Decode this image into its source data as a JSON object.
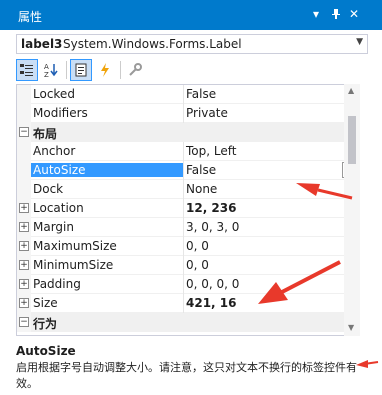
{
  "window": {
    "title": "属性",
    "pin_glyph": "▾",
    "autohide_glyph": "ᛘ",
    "close_glyph": "✕"
  },
  "object_selector": {
    "name": "label3",
    "type": "System.Windows.Forms.Label"
  },
  "toolbar": {
    "buttons": [
      {
        "icon": "categorized-icon"
      },
      {
        "icon": "alphabetical-icon"
      },
      {
        "icon": "properties-icon"
      },
      {
        "icon": "events-icon"
      },
      {
        "icon": "property-pages-icon"
      }
    ]
  },
  "grid": {
    "rows": [
      {
        "kind": "prop",
        "name": "Locked",
        "value": "False",
        "expandable": false,
        "bold": false
      },
      {
        "kind": "prop",
        "name": "Modifiers",
        "value": "Private",
        "expandable": false,
        "bold": false
      },
      {
        "kind": "category",
        "name": "布局",
        "glyph": "⊟"
      },
      {
        "kind": "prop",
        "name": "Anchor",
        "value": "Top, Left",
        "expandable": false,
        "bold": false
      },
      {
        "kind": "prop",
        "name": "AutoSize",
        "value": "False",
        "expandable": false,
        "bold": false,
        "selected": true
      },
      {
        "kind": "prop",
        "name": "Dock",
        "value": "None",
        "expandable": false,
        "bold": false
      },
      {
        "kind": "prop",
        "name": "Location",
        "value": "12, 236",
        "expandable": true,
        "bold": true
      },
      {
        "kind": "prop",
        "name": "Margin",
        "value": "3, 0, 3, 0",
        "expandable": true,
        "bold": false
      },
      {
        "kind": "prop",
        "name": "MaximumSize",
        "value": "0, 0",
        "expandable": true,
        "bold": false
      },
      {
        "kind": "prop",
        "name": "MinimumSize",
        "value": "0, 0",
        "expandable": true,
        "bold": false
      },
      {
        "kind": "prop",
        "name": "Padding",
        "value": "0, 0, 0, 0",
        "expandable": true,
        "bold": false
      },
      {
        "kind": "prop",
        "name": "Size",
        "value": "421, 16",
        "expandable": true,
        "bold": true
      },
      {
        "kind": "category",
        "name": "行为",
        "glyph": "⊟"
      }
    ],
    "expand_glyph": "+",
    "collapse_glyph": "−"
  },
  "help": {
    "title": "AutoSize",
    "description": "启用根据字号自动调整大小。请注意，这只对文本不换行的标签控件有效。"
  },
  "colors": {
    "titlebar": "#007acc",
    "selection": "#3399ff",
    "annotation_arrow": "#e8392b"
  }
}
